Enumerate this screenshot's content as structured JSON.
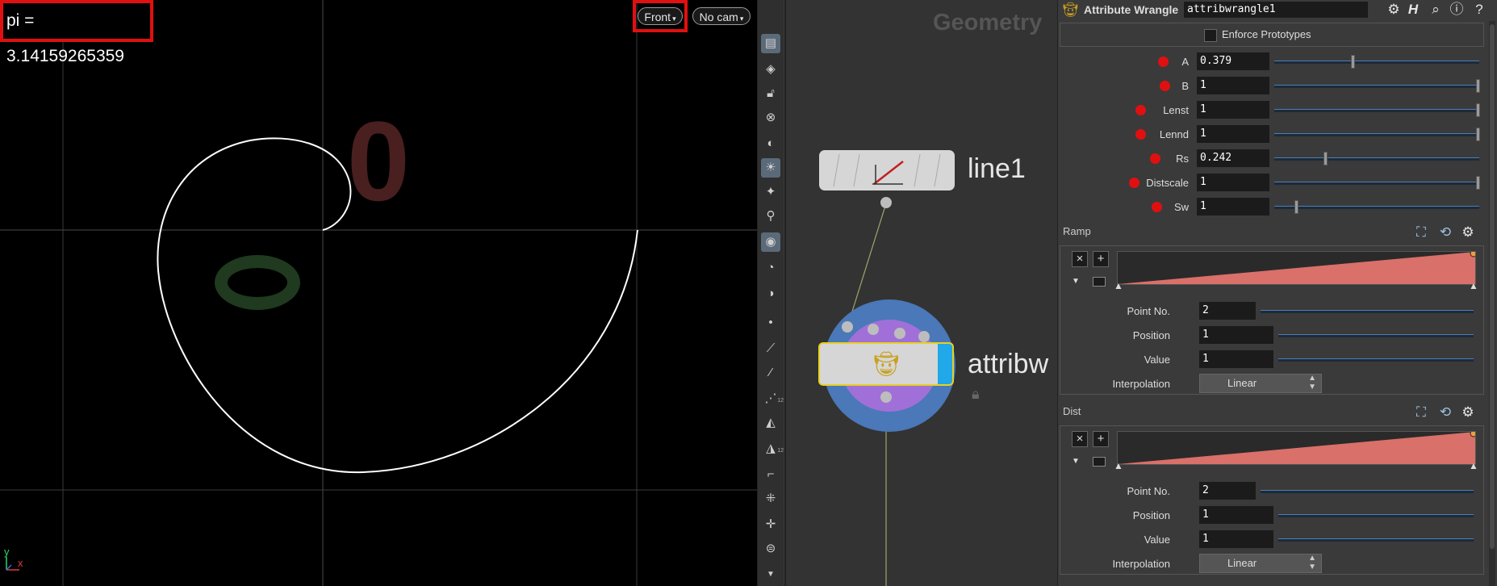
{
  "viewport": {
    "pi_readout": "pi = 3.14159265359",
    "view_menu": "Front",
    "camera_menu": "No cam",
    "axis_y": "y",
    "axis_x": "x",
    "numeral_red": "0",
    "numeral_green": "0"
  },
  "toolbar": {
    "tools": [
      "display-options-icon",
      "selection-mask-icon",
      "lock-icon",
      "ghost-icon",
      "shading-icon",
      "light-icon",
      "headlight-icon",
      "light-link-icon",
      "camera-icon",
      "eye-icon",
      "point-icon",
      "brush-icon",
      "pin-icon",
      "number-points-icon",
      "geometry-icon",
      "number-prims-icon",
      "measure-icon",
      "snapping-icon",
      "handle-icon",
      "save-view-icon"
    ],
    "badge": "12"
  },
  "network": {
    "title": "Geometry",
    "nodes": [
      {
        "name": "line1",
        "icon": "line-node-icon"
      },
      {
        "name": "attribw",
        "icon": "wrangle-node-icon"
      }
    ]
  },
  "params": {
    "node_type": "Attribute Wrangle",
    "node_name": "attribwrangle1",
    "enforce_prototypes": "Enforce Prototypes",
    "rows": [
      {
        "label": "A",
        "value": "0.379",
        "norm": 0.379
      },
      {
        "label": "B",
        "value": "1",
        "norm": 1
      },
      {
        "label": "Lenst",
        "value": "1",
        "norm": 1
      },
      {
        "label": "Lennd",
        "value": "1",
        "norm": 1
      },
      {
        "label": "Rs",
        "value": "0.242",
        "norm": 0.242
      },
      {
        "label": "Distscale",
        "value": "1",
        "norm": 1
      },
      {
        "label": "Sw",
        "value": "1",
        "norm": 0.1
      }
    ],
    "ramps": [
      {
        "title": "Ramp",
        "point_no_label": "Point No.",
        "point_no": "2",
        "position_label": "Position",
        "position": "1",
        "value_label": "Value",
        "value": "1",
        "interp_label": "Interpolation",
        "interp": "Linear"
      },
      {
        "title": "Dist",
        "point_no_label": "Point No.",
        "point_no": "2",
        "position_label": "Position",
        "position": "1",
        "value_label": "Value",
        "value": "1",
        "interp_label": "Interpolation",
        "interp": "Linear"
      }
    ]
  },
  "colors": {
    "highlight_red": "#e01010",
    "ramp_fill": "#d9706a",
    "slider_blue": "#4a7fb8",
    "node_purple": "#a070d8",
    "node_blue": "#4a78b8",
    "wire_green": "#9aa86a"
  }
}
